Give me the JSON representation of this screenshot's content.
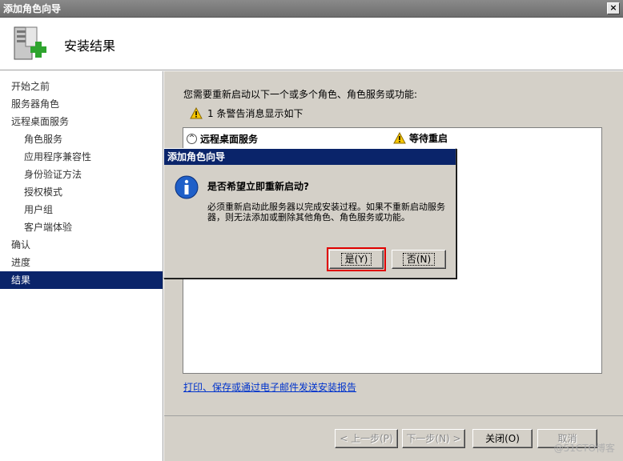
{
  "window": {
    "title": "添加角色向导",
    "close_glyph": "×"
  },
  "header": {
    "title": "安装结果",
    "icon": "server-roles-add-icon"
  },
  "sidebar": {
    "items": [
      {
        "label": "开始之前",
        "sub": false,
        "active": false
      },
      {
        "label": "服务器角色",
        "sub": false,
        "active": false
      },
      {
        "label": "远程桌面服务",
        "sub": false,
        "active": false
      },
      {
        "label": "角色服务",
        "sub": true,
        "active": false
      },
      {
        "label": "应用程序兼容性",
        "sub": true,
        "active": false
      },
      {
        "label": "身份验证方法",
        "sub": true,
        "active": false
      },
      {
        "label": "授权模式",
        "sub": true,
        "active": false
      },
      {
        "label": "用户组",
        "sub": true,
        "active": false
      },
      {
        "label": "客户端体验",
        "sub": true,
        "active": false
      },
      {
        "label": "确认",
        "sub": false,
        "active": false
      },
      {
        "label": "进度",
        "sub": false,
        "active": false
      },
      {
        "label": "结果",
        "sub": false,
        "active": true
      }
    ]
  },
  "content": {
    "intro": "您需要重新启动以下一个或多个角色、角色服务或功能:",
    "warning_summary": "1 条警告消息显示如下",
    "list": {
      "collapse_glyph": "^",
      "role": "远程桌面服务",
      "status": "等待重启"
    },
    "report_link": "打印、保存或通过电子邮件发送安装报告"
  },
  "footer": {
    "prev": "< 上一步(P)",
    "next": "下一步(N) >",
    "close": "关闭(O)",
    "cancel": "取消"
  },
  "dialog": {
    "title": "添加角色向导",
    "question": "是否希望立即重新启动?",
    "description": "必须重新启动此服务器以完成安装过程。如果不重新启动服务器，则无法添加或删除其他角色、角色服务或功能。",
    "yes": "是(Y)",
    "no": "否(N)"
  },
  "watermark": "@51CTO博客",
  "colors": {
    "selection": "#0a246a",
    "highlight_border": "#e00000",
    "link": "#0033cc"
  }
}
